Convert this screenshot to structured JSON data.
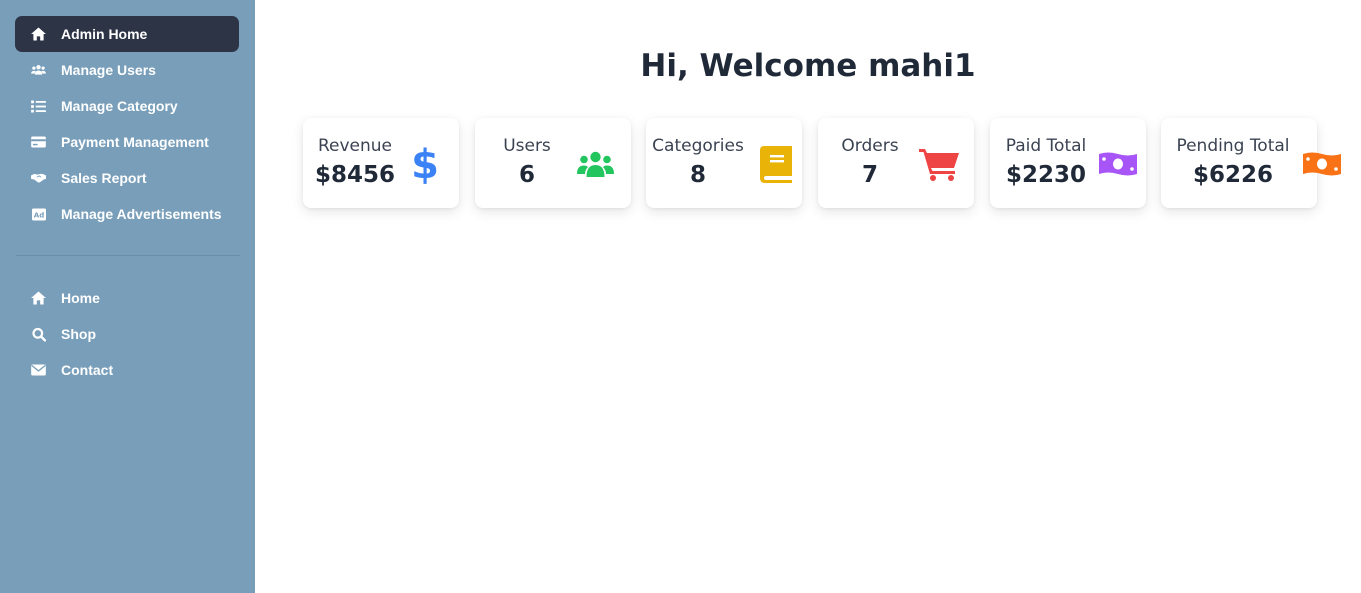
{
  "sidebar": {
    "items": [
      {
        "label": "Admin Home",
        "icon": "home-icon",
        "active": true
      },
      {
        "label": "Manage Users",
        "icon": "users-icon"
      },
      {
        "label": "Manage Category",
        "icon": "list-icon"
      },
      {
        "label": "Payment Management",
        "icon": "credit-card-icon"
      },
      {
        "label": "Sales Report",
        "icon": "handshake-icon"
      },
      {
        "label": "Manage Advertisements",
        "icon": "ad-icon"
      }
    ],
    "secondary_items": [
      {
        "label": "Home",
        "icon": "home-icon"
      },
      {
        "label": "Shop",
        "icon": "search-icon"
      },
      {
        "label": "Contact",
        "icon": "envelope-icon"
      }
    ]
  },
  "main": {
    "welcome": "Hi, Welcome mahi1",
    "cards": [
      {
        "label": "Revenue",
        "value": "$8456",
        "icon": "dollar-icon",
        "color": "#3b82f6"
      },
      {
        "label": "Users",
        "value": "6",
        "icon": "users-icon",
        "color": "#22c55e"
      },
      {
        "label": "Categories",
        "value": "8",
        "icon": "book-icon",
        "color": "#eab308"
      },
      {
        "label": "Orders",
        "value": "7",
        "icon": "cart-icon",
        "color": "#ef4444"
      },
      {
        "label": "Paid Total",
        "value": "$2230",
        "icon": "money-bill-icon",
        "color": "#a855f7"
      },
      {
        "label": "Pending Total",
        "value": "$6226",
        "icon": "money-bill-icon",
        "color": "#f97316"
      }
    ]
  },
  "colors": {
    "sidebar_bg": "#789eba",
    "active_item_bg": "#2c3445",
    "text_dark": "#1f2937"
  }
}
